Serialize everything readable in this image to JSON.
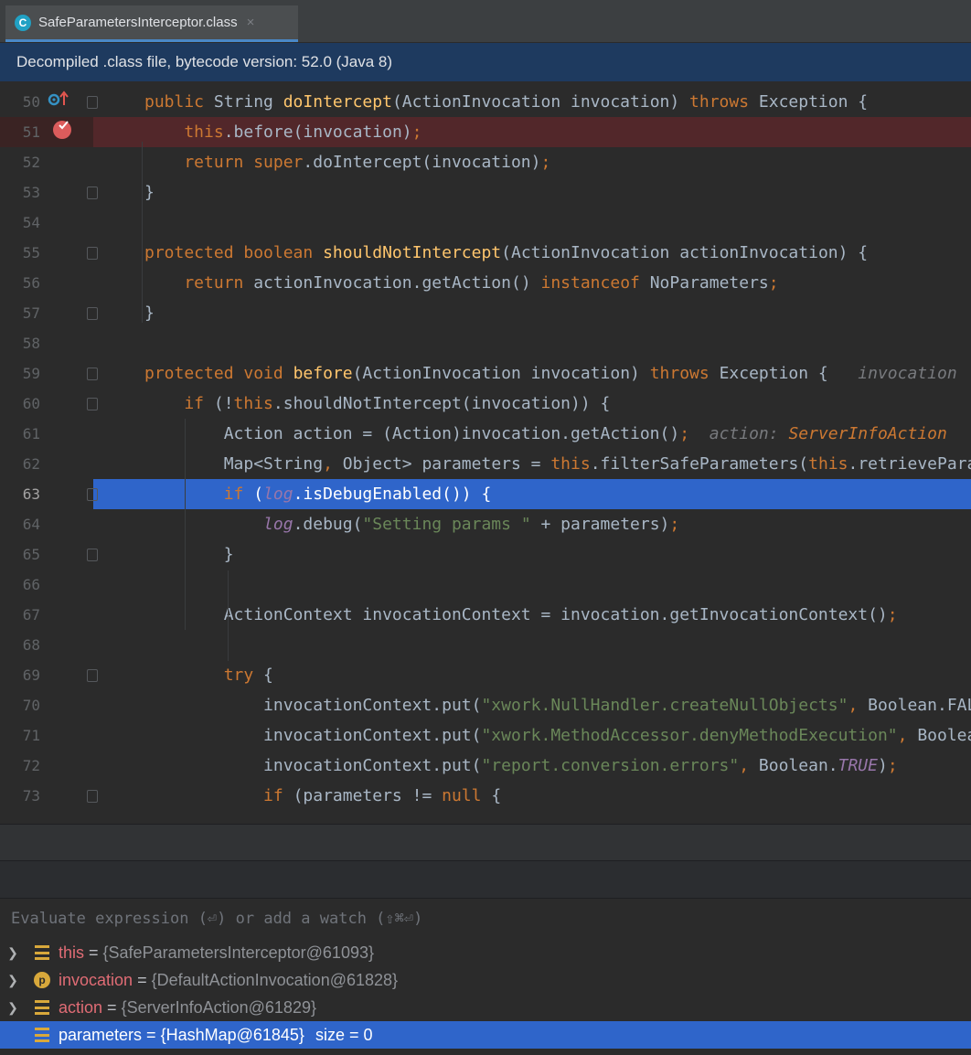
{
  "tab": {
    "icon_letter": "C",
    "label": "SafeParametersInterceptor.class",
    "close": "×"
  },
  "banner": "Decompiled .class file, bytecode version: 52.0 (Java 8)",
  "lines": [
    {
      "n": "50",
      "t": [
        [
          "kw",
          "public "
        ],
        [
          "",
          "String "
        ],
        [
          "fn",
          "doIntercept"
        ],
        [
          "",
          "(ActionInvocation invocation) "
        ],
        [
          "kw",
          "throws "
        ],
        [
          "",
          "Exception {"
        ]
      ]
    },
    {
      "n": "51",
      "t": [
        [
          "kw",
          "    this"
        ],
        [
          "",
          "."
        ],
        [
          "",
          "before(invocation)"
        ],
        [
          "kw",
          ";"
        ]
      ]
    },
    {
      "n": "52",
      "t": [
        [
          "kw",
          "    return super"
        ],
        [
          "",
          ".doIntercept(invocation)"
        ],
        [
          "kw",
          ";"
        ]
      ]
    },
    {
      "n": "53",
      "t": [
        [
          "",
          "}"
        ]
      ]
    },
    {
      "n": "54",
      "t": []
    },
    {
      "n": "55",
      "t": [
        [
          "kw",
          "protected boolean "
        ],
        [
          "fn",
          "shouldNotIntercept"
        ],
        [
          "",
          "(ActionInvocation actionInvocation) {"
        ]
      ]
    },
    {
      "n": "56",
      "t": [
        [
          "kw",
          "    return "
        ],
        [
          "",
          "actionInvocation.getAction() "
        ],
        [
          "kw",
          "instanceof "
        ],
        [
          "",
          "NoParameters"
        ],
        [
          "kw",
          ";"
        ]
      ]
    },
    {
      "n": "57",
      "t": [
        [
          "",
          "}"
        ]
      ]
    },
    {
      "n": "58",
      "t": []
    },
    {
      "n": "59",
      "t": [
        [
          "kw",
          "protected void "
        ],
        [
          "fn",
          "before"
        ],
        [
          "",
          "(ActionInvocation invocation) "
        ],
        [
          "kw",
          "throws "
        ],
        [
          "",
          "Exception {   "
        ],
        [
          "hint",
          "invocation"
        ]
      ]
    },
    {
      "n": "60",
      "t": [
        [
          "kw",
          "    if "
        ],
        [
          "",
          "(!"
        ],
        [
          "kw",
          "this"
        ],
        [
          "",
          ".shouldNotIntercept(invocation)) {"
        ]
      ]
    },
    {
      "n": "61",
      "t": [
        [
          "",
          "        Action action = (Action)invocation.getAction()"
        ],
        [
          "kw",
          ";"
        ],
        [
          "",
          "  "
        ],
        [
          "hint",
          "action: "
        ],
        [
          "hintval",
          "ServerInfoAction"
        ]
      ]
    },
    {
      "n": "62",
      "t": [
        [
          "",
          "        Map<String"
        ],
        [
          "kw",
          ", "
        ],
        [
          "",
          "Object> parameters = "
        ],
        [
          "kw",
          "this"
        ],
        [
          "",
          ".filterSafeParameters("
        ],
        [
          "kw",
          "this"
        ],
        [
          "",
          ".retrieveParameters"
        ]
      ]
    },
    {
      "n": "63",
      "t": [
        [
          "kw",
          "        if "
        ],
        [
          "",
          "("
        ],
        [
          "log",
          "log"
        ],
        [
          "",
          ".isDebugEnabled()) {"
        ]
      ]
    },
    {
      "n": "64",
      "t": [
        [
          "log",
          "            log"
        ],
        [
          "",
          ".debug("
        ],
        [
          "str",
          "\"Setting params \""
        ],
        [
          "",
          " + parameters)"
        ],
        [
          "kw",
          ";"
        ]
      ]
    },
    {
      "n": "65",
      "t": [
        [
          "",
          "        }"
        ]
      ]
    },
    {
      "n": "66",
      "t": []
    },
    {
      "n": "67",
      "t": [
        [
          "",
          "        ActionContext invocationContext = invocation.getInvocationContext()"
        ],
        [
          "kw",
          ";"
        ]
      ]
    },
    {
      "n": "68",
      "t": []
    },
    {
      "n": "69",
      "t": [
        [
          "kw",
          "        try "
        ],
        [
          "",
          "{"
        ]
      ]
    },
    {
      "n": "70",
      "t": [
        [
          "",
          "            invocationContext.put("
        ],
        [
          "str",
          "\"xwork.NullHandler.createNullObjects\""
        ],
        [
          "kw",
          ", "
        ],
        [
          "",
          "Boolean.FALSE"
        ]
      ]
    },
    {
      "n": "71",
      "t": [
        [
          "",
          "            invocationContext.put("
        ],
        [
          "str",
          "\"xwork.MethodAccessor.denyMethodExecution\""
        ],
        [
          "kw",
          ", "
        ],
        [
          "",
          "Boolean"
        ]
      ]
    },
    {
      "n": "72",
      "t": [
        [
          "",
          "            invocationContext.put("
        ],
        [
          "str",
          "\"report.conversion.errors\""
        ],
        [
          "kw",
          ", "
        ],
        [
          "",
          "Boolean."
        ],
        [
          "tru",
          "TRUE"
        ],
        [
          "",
          ")"
        ],
        [
          "kw",
          ";"
        ]
      ]
    },
    {
      "n": "73",
      "t": [
        [
          "kw",
          "            if "
        ],
        [
          "",
          "(parameters != "
        ],
        [
          "kw",
          "null"
        ],
        [
          "",
          " {"
        ]
      ]
    }
  ],
  "eval_placeholder": "Evaluate expression (⏎) or add a watch (⇧⌘⏎)",
  "variables": [
    {
      "name": "this",
      "value": "{SafeParametersInterceptor@61093}",
      "icon": "field-icon",
      "size": ""
    },
    {
      "name": "invocation",
      "value": "{DefaultActionInvocation@61828}",
      "icon": "parameter-icon",
      "icon_letter": "p",
      "size": ""
    },
    {
      "name": "action",
      "value": "{ServerInfoAction@61829}",
      "icon": "field-icon",
      "size": ""
    },
    {
      "name": "parameters",
      "value": "{HashMap@61845}",
      "icon": "field-icon",
      "size": "size = 0"
    }
  ]
}
